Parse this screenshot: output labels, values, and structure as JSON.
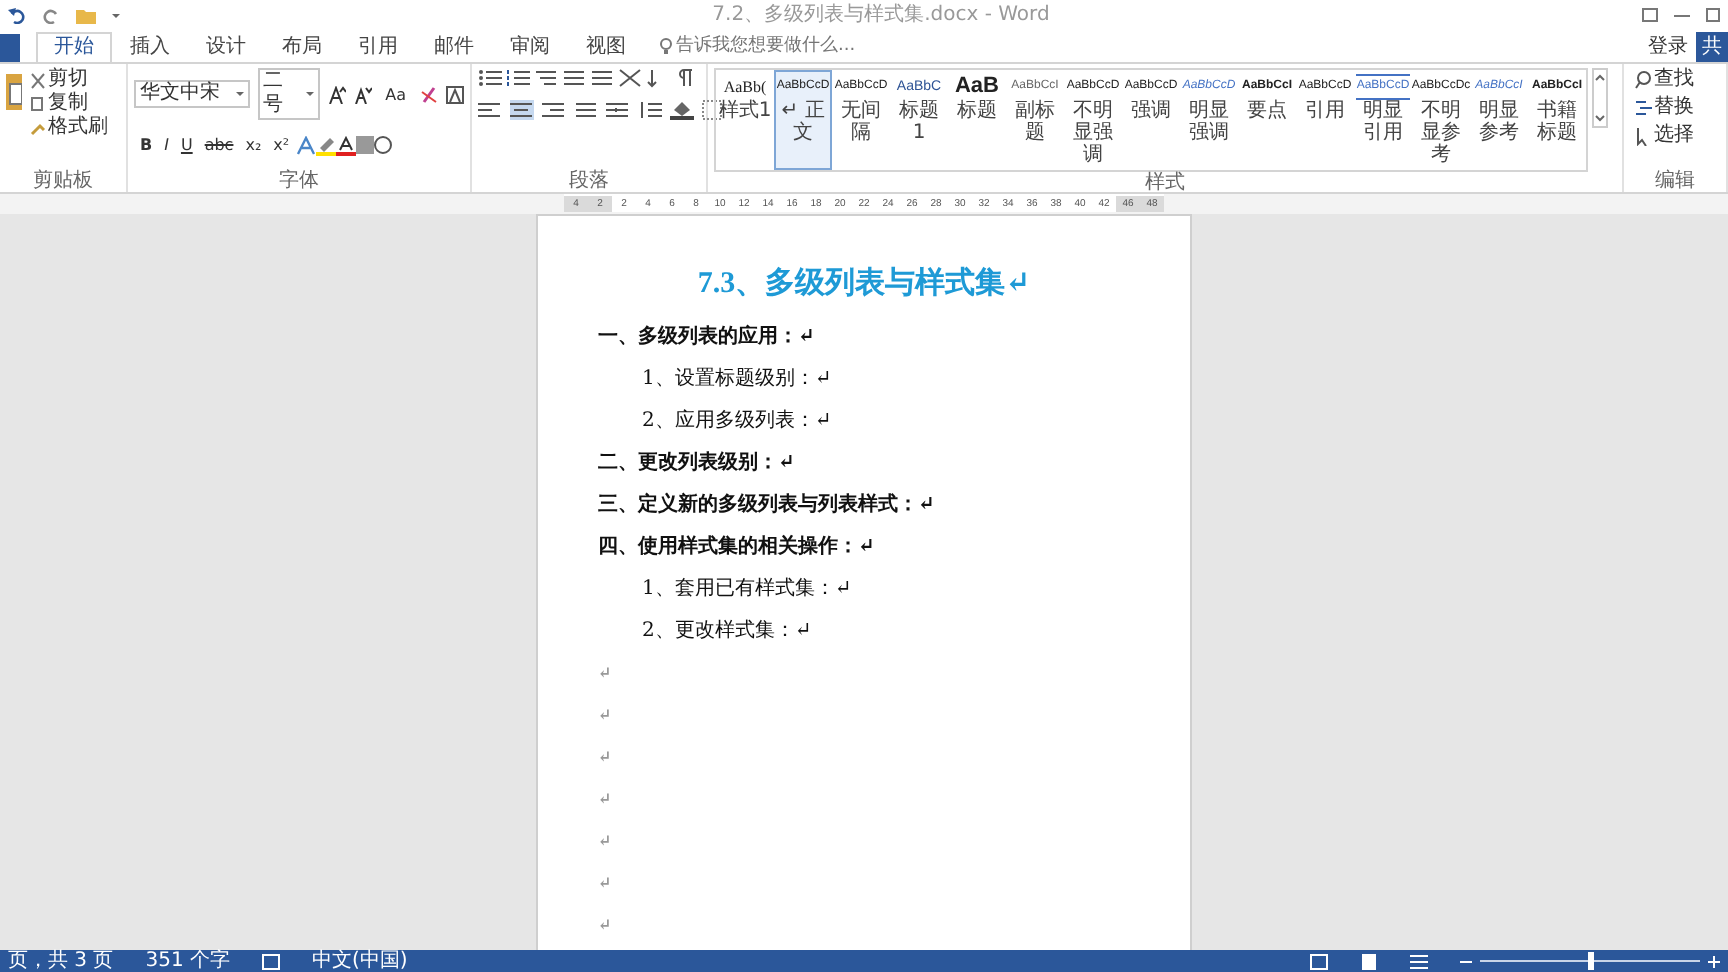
{
  "window": {
    "title": "7.2、多级列表与样式集.docx - Word"
  },
  "tabs": [
    {
      "label": "开始",
      "selected": true
    },
    {
      "label": "插入",
      "selected": false
    },
    {
      "label": "设计",
      "selected": false
    },
    {
      "label": "布局",
      "selected": false
    },
    {
      "label": "引用",
      "selected": false
    },
    {
      "label": "邮件",
      "selected": false
    },
    {
      "label": "审阅",
      "selected": false
    },
    {
      "label": "视图",
      "selected": false
    }
  ],
  "tell_me": {
    "placeholder": "告诉我您想要做什么..."
  },
  "account": {
    "sign_in": "登录",
    "share": "共"
  },
  "clipboard": {
    "label": "剪贴板",
    "buttons": [
      "剪切",
      "复制",
      "格式刷"
    ]
  },
  "font": {
    "label": "字体",
    "name": "华文中宋",
    "size": "二号",
    "case": "Aa",
    "bold": "B",
    "italic": "I",
    "underline": "U",
    "strike": "abc",
    "subscript": "x₂",
    "superscript": "x²"
  },
  "paragraph": {
    "label": "段落",
    "align_buttons": [
      {
        "selected": false
      },
      {
        "selected": true
      },
      {
        "selected": false
      },
      {
        "selected": false
      },
      {
        "selected": false
      }
    ]
  },
  "styles": {
    "label": "样式",
    "items": [
      {
        "preview": "AaBb(",
        "name": "样式1",
        "kind": "large",
        "selected": false
      },
      {
        "preview": "AaBbCcD",
        "name": "↵ 正文",
        "kind": "normal",
        "selected": true
      },
      {
        "preview": "AaBbCcD",
        "name": "无间隔",
        "kind": "normal",
        "selected": false
      },
      {
        "preview": "AaBbC",
        "name": "标题 1",
        "kind": "heading",
        "selected": false
      },
      {
        "preview": "AaB",
        "name": "标题",
        "kind": "title",
        "selected": false
      },
      {
        "preview": "AaBbCcI",
        "name": "副标题",
        "kind": "subtle",
        "selected": false
      },
      {
        "preview": "AaBbCcD",
        "name": "不明显强调",
        "kind": "normal",
        "selected": false
      },
      {
        "preview": "AaBbCcD",
        "name": "强调",
        "kind": "normal",
        "selected": false
      },
      {
        "preview": "AaBbCcD",
        "name": "明显强调",
        "kind": "blue",
        "selected": false
      },
      {
        "preview": "AaBbCcI",
        "name": "要点",
        "kind": "bold",
        "selected": false
      },
      {
        "preview": "AaBbCcD",
        "name": "引用",
        "kind": "normal",
        "selected": false
      },
      {
        "preview": "AaBbCcD",
        "name": "明显引用",
        "kind": "quote",
        "selected": false
      },
      {
        "preview": "AaBbCcDc",
        "name": "不明显参考",
        "kind": "normal",
        "selected": false
      },
      {
        "preview": "AaBbCcI",
        "name": "明显参考",
        "kind": "blue",
        "selected": false
      },
      {
        "preview": "AaBbCcI",
        "name": "书籍标题",
        "kind": "bold",
        "selected": false
      }
    ]
  },
  "editing": {
    "label": "编辑",
    "buttons": [
      "查找",
      "替换",
      "选择"
    ]
  },
  "ruler": [
    {
      "label": "4",
      "margin": true
    },
    {
      "label": "2",
      "margin": true
    },
    {
      "label": "2",
      "margin": false
    },
    {
      "label": "4",
      "margin": false
    },
    {
      "label": "6",
      "margin": false
    },
    {
      "label": "8",
      "margin": false
    },
    {
      "label": "10",
      "margin": false
    },
    {
      "label": "12",
      "margin": false
    },
    {
      "label": "14",
      "margin": false
    },
    {
      "label": "16",
      "margin": false
    },
    {
      "label": "18",
      "margin": false
    },
    {
      "label": "20",
      "margin": false
    },
    {
      "label": "22",
      "margin": false
    },
    {
      "label": "24",
      "margin": false
    },
    {
      "label": "26",
      "margin": false
    },
    {
      "label": "28",
      "margin": false
    },
    {
      "label": "30",
      "margin": false
    },
    {
      "label": "32",
      "margin": false
    },
    {
      "label": "34",
      "margin": false
    },
    {
      "label": "36",
      "margin": false
    },
    {
      "label": "38",
      "margin": false
    },
    {
      "label": "40",
      "margin": false
    },
    {
      "label": "42",
      "margin": false
    },
    {
      "label": "46",
      "margin": true
    },
    {
      "label": "48",
      "margin": true
    }
  ],
  "document": {
    "title": "7.3、多级列表与样式集↵",
    "paragraphs": [
      {
        "text": "一、多级列表的应用：↵",
        "children": [
          {
            "text": "1、设置标题级别：↵"
          },
          {
            "text": "2、应用多级列表：↵"
          }
        ]
      },
      {
        "text": "二、更改列表级别：↵"
      },
      {
        "text": "三、定义新的多级列表与列表样式：↵"
      },
      {
        "text": "四、使用样式集的相关操作：↵",
        "children": [
          {
            "text": "1、套用已有样式集：↵"
          },
          {
            "text": "2、更改样式集：↵"
          }
        ]
      },
      {
        "text": "↵"
      },
      {
        "text": "↵"
      },
      {
        "text": "↵"
      },
      {
        "text": "↵"
      },
      {
        "text": "↵"
      },
      {
        "text": "↵"
      },
      {
        "text": "↵"
      }
    ]
  },
  "status_bar": {
    "page": "页，共 3 页",
    "words": "351 个字",
    "language": "中文(中国)",
    "zoom": {
      "level": 0.5
    }
  }
}
